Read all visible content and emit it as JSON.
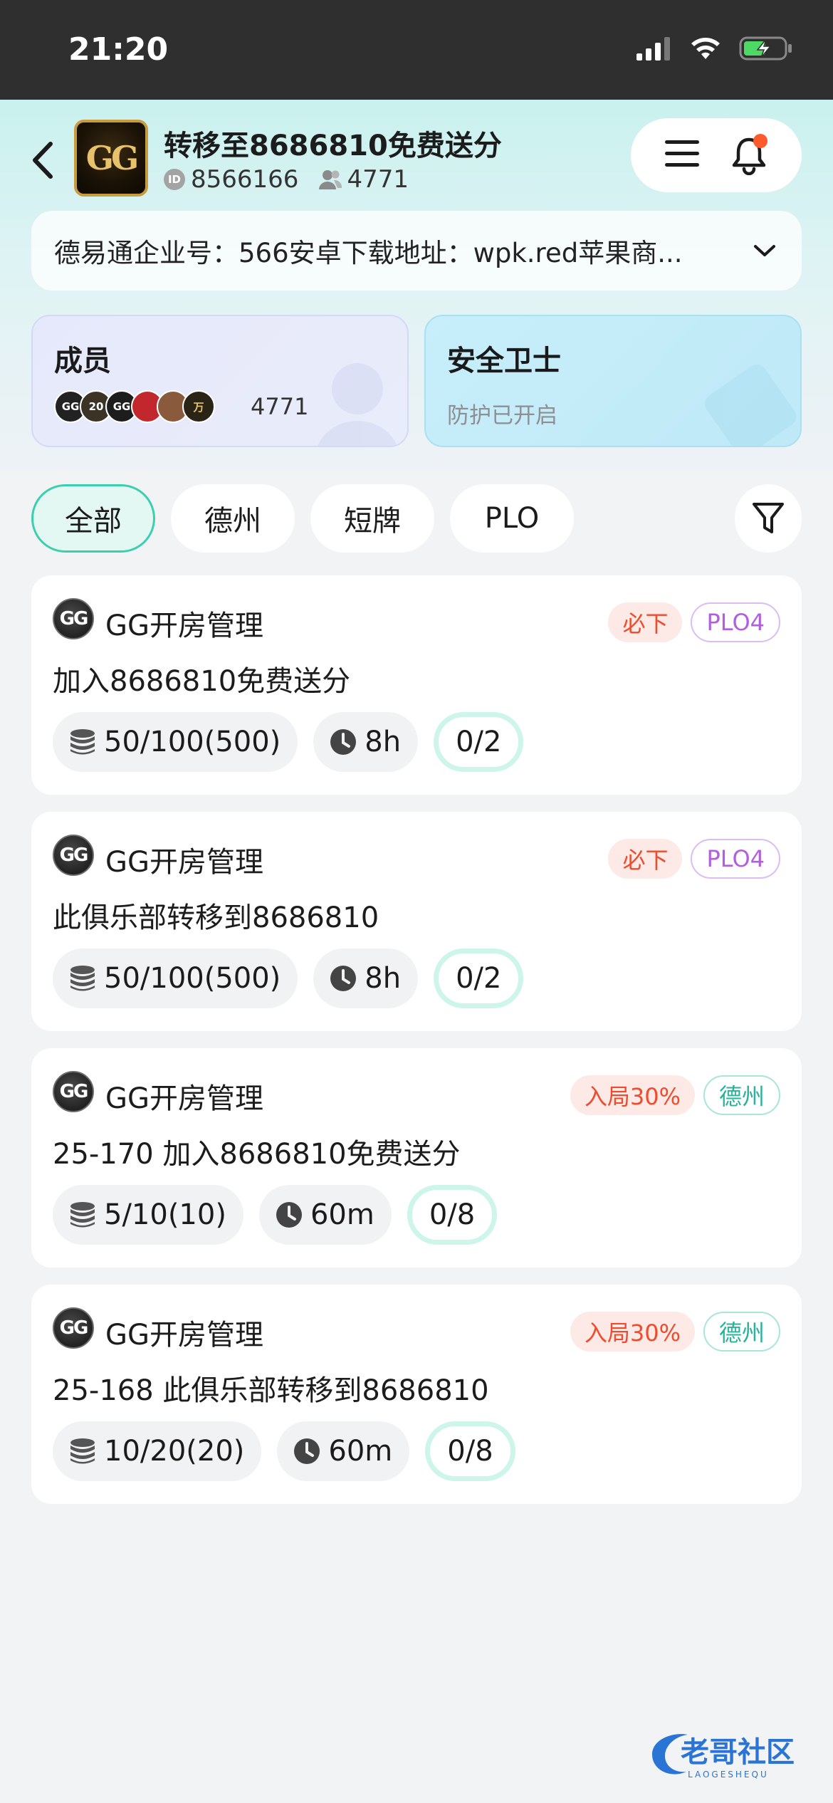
{
  "status_bar": {
    "time": "21:20"
  },
  "club": {
    "logo_text": "GG",
    "title": "转移至8686810免费送分",
    "id_label": "ID",
    "id": "8566166",
    "member_count": "4771"
  },
  "notice": {
    "text": "德易通企业号：566安卓下载地址：wpk.red苹果商..."
  },
  "members_card": {
    "title": "成员",
    "count": "4771",
    "avatars": [
      "GG",
      "20",
      "GG",
      "",
      "",
      "万"
    ]
  },
  "security_card": {
    "title": "安全卫士",
    "subtitle": "防护已开启"
  },
  "tabs": [
    {
      "label": "全部",
      "active": true
    },
    {
      "label": "德州",
      "active": false
    },
    {
      "label": "短牌",
      "active": false
    },
    {
      "label": "PLO",
      "active": false
    }
  ],
  "games": [
    {
      "host": "GG开房管理",
      "logo": "GG",
      "tags": [
        {
          "text": "必下",
          "style": "red"
        },
        {
          "text": "PLO4",
          "style": "purple"
        }
      ],
      "name": "加入8686810免费送分",
      "blinds": "50/100(500)",
      "duration": "8h",
      "seats": "0/2"
    },
    {
      "host": "GG开房管理",
      "logo": "GG",
      "tags": [
        {
          "text": "必下",
          "style": "red"
        },
        {
          "text": "PLO4",
          "style": "purple"
        }
      ],
      "name": "此俱乐部转移到8686810",
      "blinds": "50/100(500)",
      "duration": "8h",
      "seats": "0/2"
    },
    {
      "host": "GG开房管理",
      "logo": "GG",
      "tags": [
        {
          "text": "入局30%",
          "style": "red"
        },
        {
          "text": "德州",
          "style": "teal"
        }
      ],
      "name": "25-170 加入8686810免费送分",
      "blinds": "5/10(10)",
      "duration": "60m",
      "seats": "0/8"
    },
    {
      "host": "GG开房管理",
      "logo": "GG",
      "tags": [
        {
          "text": "入局30%",
          "style": "red"
        },
        {
          "text": "德州",
          "style": "teal"
        }
      ],
      "name": "25-168 此俱乐部转移到8686810",
      "blinds": "10/20(20)",
      "duration": "60m",
      "seats": "0/8"
    }
  ],
  "watermark": {
    "text": "老哥社区",
    "sub": "LAOGESHEQU"
  },
  "colors": {
    "accent_teal": "#3ccfad",
    "tag_red": "#ef4c2d",
    "tag_purple": "#b25ee0",
    "notification_dot": "#ff5a2b"
  }
}
